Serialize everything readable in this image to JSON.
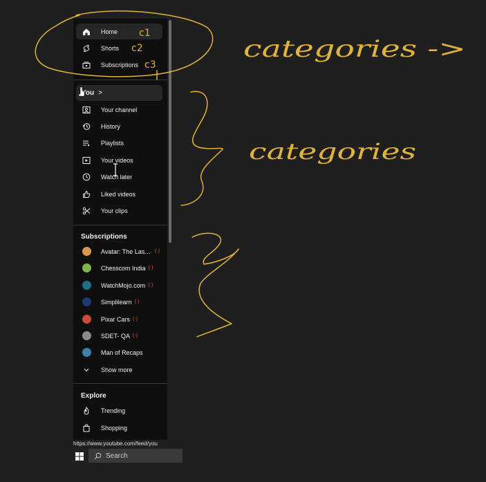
{
  "sidebar": {
    "top_items": [
      {
        "label": "Home",
        "icon": "home-icon",
        "active": true
      },
      {
        "label": "Shorts",
        "icon": "shorts-icon"
      },
      {
        "label": "Subscriptions",
        "icon": "subscriptions-icon"
      }
    ],
    "you": {
      "label": "You",
      "chevron": ">"
    },
    "you_items": [
      {
        "label": "Your channel",
        "icon": "your-channel-icon"
      },
      {
        "label": "History",
        "icon": "history-icon"
      },
      {
        "label": "Playlists",
        "icon": "playlists-icon"
      },
      {
        "label": "Your videos",
        "icon": "your-videos-icon"
      },
      {
        "label": "Watch later",
        "icon": "watch-later-icon"
      },
      {
        "label": "Liked videos",
        "icon": "liked-videos-icon"
      },
      {
        "label": "Your clips",
        "icon": "your-clips-icon"
      }
    ],
    "subscriptions_title": "Subscriptions",
    "subscriptions": [
      {
        "label": "Avatar: The Last Airbender",
        "live": "(·)",
        "color": "#d9964f"
      },
      {
        "label": "Chesscom India",
        "live": "(·)",
        "color": "#7fb44a"
      },
      {
        "label": "WatchMojo.com",
        "live": "(·)",
        "color": "#1f6f8b"
      },
      {
        "label": "Simplilearn",
        "live": "(·)",
        "color": "#1e3a70"
      },
      {
        "label": "Pixar Cars",
        "live": "(·)",
        "color": "#c94b3a"
      },
      {
        "label": "SDET- QA",
        "live": "(·)",
        "color": "#8a8a8a"
      },
      {
        "label": "Man of Recaps",
        "live": "",
        "color": "#3d7fa8"
      }
    ],
    "show_more": "Show more",
    "explore_title": "Explore",
    "explore": [
      {
        "label": "Trending",
        "icon": "trending-icon"
      },
      {
        "label": "Shopping",
        "icon": "shopping-icon"
      }
    ]
  },
  "status_url": "https://www.youtube.com/feed/you",
  "taskbar": {
    "search_label": "Search"
  },
  "annotations": {
    "text1": "categories ->",
    "text2": "categories",
    "marks": [
      "c1",
      "c2",
      "c3"
    ]
  },
  "colors": {
    "annotation": "#e0b43a",
    "sidebar_bg": "#0f0f0f",
    "active_bg": "#272727",
    "live_red": "#ff4e45"
  }
}
